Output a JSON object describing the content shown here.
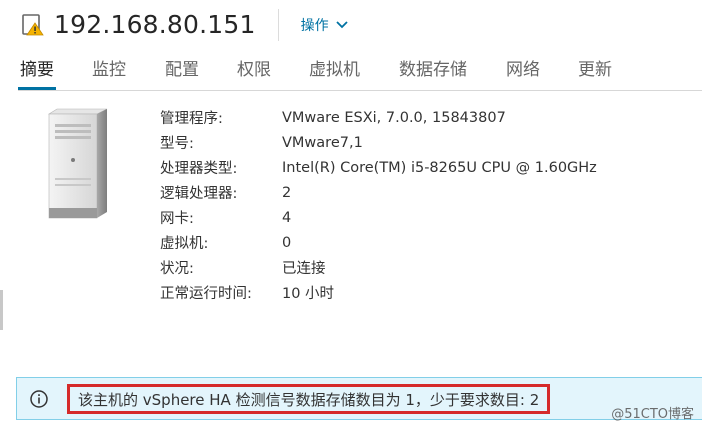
{
  "header": {
    "host_title": "192.168.80.151",
    "actions_label": "操作",
    "warning_icon": "warning-triangle-icon",
    "warning_color": "#f5b301"
  },
  "tabs": [
    {
      "label": "摘要",
      "active": true
    },
    {
      "label": "监控"
    },
    {
      "label": "配置"
    },
    {
      "label": "权限"
    },
    {
      "label": "虚拟机"
    },
    {
      "label": "数据存储"
    },
    {
      "label": "网络"
    },
    {
      "label": "更新"
    }
  ],
  "summary": {
    "rows": [
      {
        "label": "管理程序:",
        "value": "VMware ESXi, 7.0.0, 15843807"
      },
      {
        "label": "型号:",
        "value": "VMware7,1"
      },
      {
        "label": "处理器类型:",
        "value": "Intel(R) Core(TM) i5-8265U CPU @ 1.60GHz"
      },
      {
        "label": "逻辑处理器:",
        "value": "2"
      },
      {
        "label": "网卡:",
        "value": "4"
      },
      {
        "label": "虚拟机:",
        "value": "0"
      },
      {
        "label": "状况:",
        "value": "已连接"
      },
      {
        "label": "正常运行时间:",
        "value": "10 小时"
      }
    ]
  },
  "alert": {
    "message": "该主机的 vSphere HA 检测信号数据存储数目为 1，少于要求数目: 2",
    "icon": "info-circle-icon",
    "highlight_color": "#d52a2a"
  },
  "watermark": "@51CTO博客",
  "colors": {
    "accent": "#0072a3",
    "alert_bg": "#e3f5fc"
  }
}
